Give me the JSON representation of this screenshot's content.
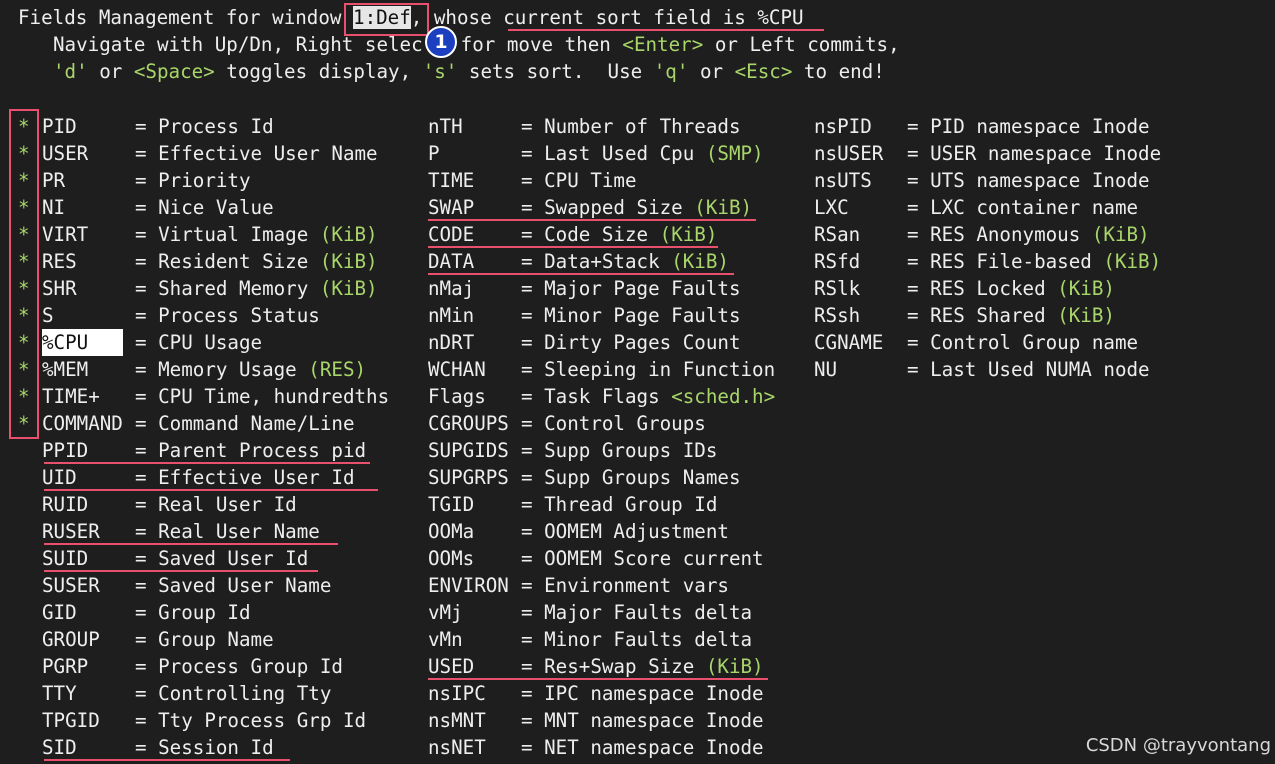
{
  "header": {
    "title_prefix": "Fields Management for window ",
    "window_name": "1:Def",
    "title_mid": ", whose ",
    "sort_text": "current sort field is %CPU",
    "nav_line_1": "Navigate with Up/Dn, Right selec",
    "nav_line_1b": "for move then ",
    "enter_key": "<Enter>",
    "nav_line_1c": " or Left commits,",
    "d_key": "'d'",
    "or_1": " or ",
    "space_key": "<Space>",
    "toggles": " toggles display, ",
    "s_key": "'s'",
    "sets_sort": " sets sort.  Use ",
    "q_key": "'q'",
    "or_2": " or ",
    "esc_key": "<Esc>",
    "to_end": " to end!"
  },
  "badge_label": "1",
  "star_glyph": "*",
  "column1": [
    {
      "key": "PID",
      "eq": "= ",
      "desc": "Process Id",
      "kib": ""
    },
    {
      "key": "USER",
      "eq": "= ",
      "desc": "Effective User Name",
      "kib": ""
    },
    {
      "key": "PR",
      "eq": "= ",
      "desc": "Priority",
      "kib": ""
    },
    {
      "key": "NI",
      "eq": "= ",
      "desc": "Nice Value",
      "kib": ""
    },
    {
      "key": "VIRT",
      "eq": "= ",
      "desc": "Virtual Image ",
      "kib": "(KiB)"
    },
    {
      "key": "RES",
      "eq": "= ",
      "desc": "Resident Size ",
      "kib": "(KiB)"
    },
    {
      "key": "SHR",
      "eq": "= ",
      "desc": "Shared Memory ",
      "kib": "(KiB)"
    },
    {
      "key": "S",
      "eq": "= ",
      "desc": "Process Status",
      "kib": ""
    },
    {
      "key": "%CPU",
      "eq": "= ",
      "desc": "CPU Usage",
      "kib": ""
    },
    {
      "key": "%MEM",
      "eq": "= ",
      "desc": "Memory Usage ",
      "kib": "(RES)"
    },
    {
      "key": "TIME+",
      "eq": "= ",
      "desc": "CPU Time, hundredths",
      "kib": ""
    },
    {
      "key": "COMMAND",
      "eq": "= ",
      "desc": "Command Name/Line",
      "kib": ""
    },
    {
      "key": "PPID",
      "eq": "= ",
      "desc": "Parent Process pid",
      "kib": ""
    },
    {
      "key": "UID",
      "eq": "= ",
      "desc": "Effective User Id",
      "kib": ""
    },
    {
      "key": "RUID",
      "eq": "= ",
      "desc": "Real User Id",
      "kib": ""
    },
    {
      "key": "RUSER",
      "eq": "= ",
      "desc": "Real User Name",
      "kib": ""
    },
    {
      "key": "SUID",
      "eq": "= ",
      "desc": "Saved User Id",
      "kib": ""
    },
    {
      "key": "SUSER",
      "eq": "= ",
      "desc": "Saved User Name",
      "kib": ""
    },
    {
      "key": "GID",
      "eq": "= ",
      "desc": "Group Id",
      "kib": ""
    },
    {
      "key": "GROUP",
      "eq": "= ",
      "desc": "Group Name",
      "kib": ""
    },
    {
      "key": "PGRP",
      "eq": "= ",
      "desc": "Process Group Id",
      "kib": ""
    },
    {
      "key": "TTY",
      "eq": "= ",
      "desc": "Controlling Tty",
      "kib": ""
    },
    {
      "key": "TPGID",
      "eq": "= ",
      "desc": "Tty Process Grp Id",
      "kib": ""
    },
    {
      "key": "SID",
      "eq": "= ",
      "desc": "Session Id",
      "kib": ""
    }
  ],
  "column2": [
    {
      "key": "nTH",
      "eq": "= ",
      "desc": "Number of Threads",
      "kib": ""
    },
    {
      "key": "P",
      "eq": "= ",
      "desc": "Last Used Cpu ",
      "kib": "(SMP)"
    },
    {
      "key": "TIME",
      "eq": "= ",
      "desc": "CPU Time",
      "kib": ""
    },
    {
      "key": "SWAP",
      "eq": "= ",
      "desc": "Swapped Size ",
      "kib": "(KiB)"
    },
    {
      "key": "CODE",
      "eq": "= ",
      "desc": "Code Size ",
      "kib": "(KiB)"
    },
    {
      "key": "DATA",
      "eq": "= ",
      "desc": "Data+Stack ",
      "kib": "(KiB)"
    },
    {
      "key": "nMaj",
      "eq": "= ",
      "desc": "Major Page Faults",
      "kib": ""
    },
    {
      "key": "nMin",
      "eq": "= ",
      "desc": "Minor Page Faults",
      "kib": ""
    },
    {
      "key": "nDRT",
      "eq": "= ",
      "desc": "Dirty Pages Count",
      "kib": ""
    },
    {
      "key": "WCHAN",
      "eq": "= ",
      "desc": "Sleeping in Function",
      "kib": ""
    },
    {
      "key": "Flags",
      "eq": "= ",
      "desc": "Task Flags ",
      "kib": "<sched.h>"
    },
    {
      "key": "CGROUPS",
      "eq": "= ",
      "desc": "Control Groups",
      "kib": ""
    },
    {
      "key": "SUPGIDS",
      "eq": "= ",
      "desc": "Supp Groups IDs",
      "kib": ""
    },
    {
      "key": "SUPGRPS",
      "eq": "= ",
      "desc": "Supp Groups Names",
      "kib": ""
    },
    {
      "key": "TGID",
      "eq": "= ",
      "desc": "Thread Group Id",
      "kib": ""
    },
    {
      "key": "OOMa",
      "eq": "= ",
      "desc": "OOMEM Adjustment",
      "kib": ""
    },
    {
      "key": "OOMs",
      "eq": "= ",
      "desc": "OOMEM Score current",
      "kib": ""
    },
    {
      "key": "ENVIRON",
      "eq": "= ",
      "desc": "Environment vars",
      "kib": ""
    },
    {
      "key": "vMj",
      "eq": "= ",
      "desc": "Major Faults delta",
      "kib": ""
    },
    {
      "key": "vMn",
      "eq": "= ",
      "desc": "Minor Faults delta",
      "kib": ""
    },
    {
      "key": "USED",
      "eq": "= ",
      "desc": "Res+Swap Size ",
      "kib": "(KiB)"
    },
    {
      "key": "nsIPC",
      "eq": "= ",
      "desc": "IPC namespace Inode",
      "kib": ""
    },
    {
      "key": "nsMNT",
      "eq": "= ",
      "desc": "MNT namespace Inode",
      "kib": ""
    },
    {
      "key": "nsNET",
      "eq": "= ",
      "desc": "NET namespace Inode",
      "kib": ""
    }
  ],
  "column3": [
    {
      "key": "nsPID",
      "eq": "= ",
      "desc": "PID namespace Inode",
      "kib": ""
    },
    {
      "key": "nsUSER",
      "eq": "= ",
      "desc": "USER namespace Inode",
      "kib": ""
    },
    {
      "key": "nsUTS",
      "eq": "= ",
      "desc": "UTS namespace Inode",
      "kib": ""
    },
    {
      "key": "LXC",
      "eq": "= ",
      "desc": "LXC container name",
      "kib": ""
    },
    {
      "key": "RSan",
      "eq": "= ",
      "desc": "RES Anonymous ",
      "kib": "(KiB)"
    },
    {
      "key": "RSfd",
      "eq": "= ",
      "desc": "RES File-based ",
      "kib": "(KiB)"
    },
    {
      "key": "RSlk",
      "eq": "= ",
      "desc": "RES Locked ",
      "kib": "(KiB)"
    },
    {
      "key": "RSsh",
      "eq": "= ",
      "desc": "RES Shared ",
      "kib": "(KiB)"
    },
    {
      "key": "CGNAME",
      "eq": "= ",
      "desc": "Control Group name",
      "kib": ""
    },
    {
      "key": "NU",
      "eq": "= ",
      "desc": "Last Used NUMA node",
      "kib": ""
    }
  ],
  "watermark": "CSDN @trayvontang",
  "colors": {
    "background": "#1e1e1e",
    "text": "#eeeeee",
    "accent_green": "#a8d66a",
    "annotation_red": "#e8506e",
    "badge_blue": "#1b3fbf"
  }
}
